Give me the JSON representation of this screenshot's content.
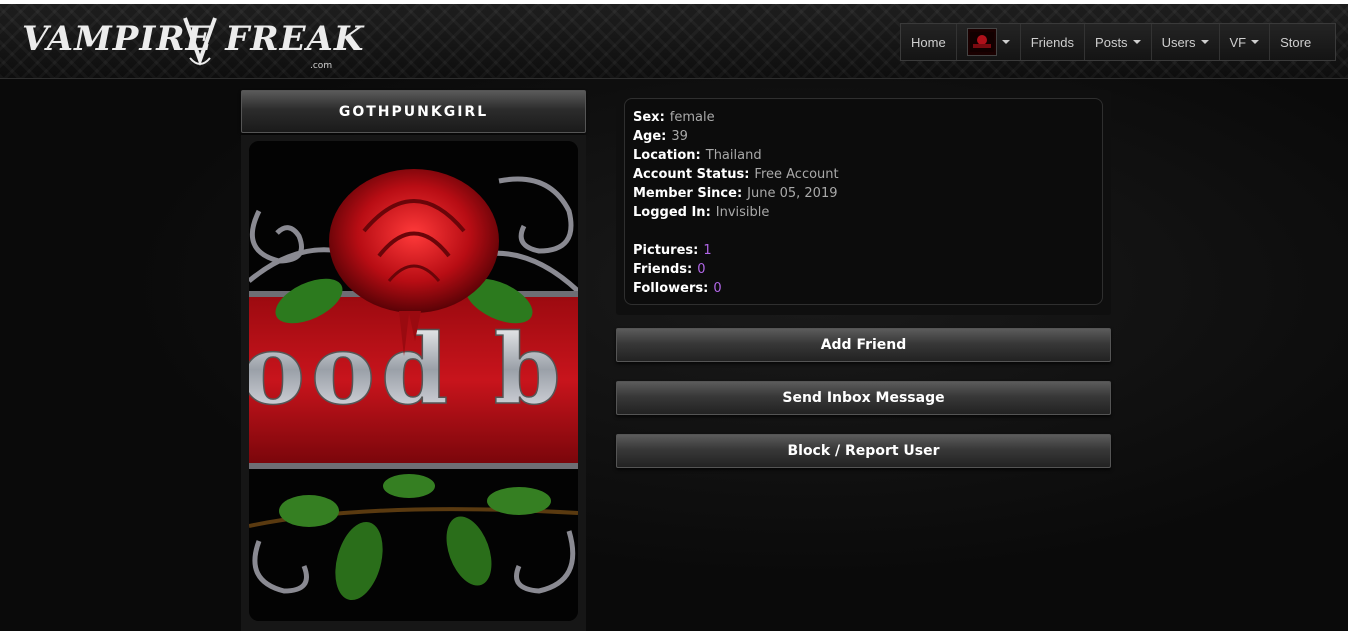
{
  "header": {
    "logo_text": "VAMPIRE FREAKS",
    "logo_sub": ".com",
    "nav": {
      "home": "Home",
      "friends": "Friends",
      "posts": "Posts",
      "users": "Users",
      "vf": "VF",
      "store": "Store"
    }
  },
  "profile": {
    "username": "GOTHPUNKGIRL",
    "picture_text": "ood b",
    "details": {
      "sex_label": "Sex:",
      "sex": "female",
      "age_label": "Age:",
      "age": "39",
      "location_label": "Location:",
      "location": "Thailand",
      "status_label": "Account Status:",
      "status": "Free Account",
      "since_label": "Member Since:",
      "since": "June 05, 2019",
      "logged_label": "Logged In:",
      "logged": "Invisible"
    },
    "stats": {
      "pictures_label": "Pictures:",
      "pictures": "1",
      "friends_label": "Friends:",
      "friends": "0",
      "followers_label": "Followers:",
      "followers": "0"
    },
    "actions": {
      "add_friend": "Add Friend",
      "send_message": "Send Inbox Message",
      "block_report": "Block / Report User"
    }
  },
  "colors": {
    "accent_purple": "#b066e6",
    "rose_red": "#c0101a",
    "background": "#0a0a0a"
  }
}
